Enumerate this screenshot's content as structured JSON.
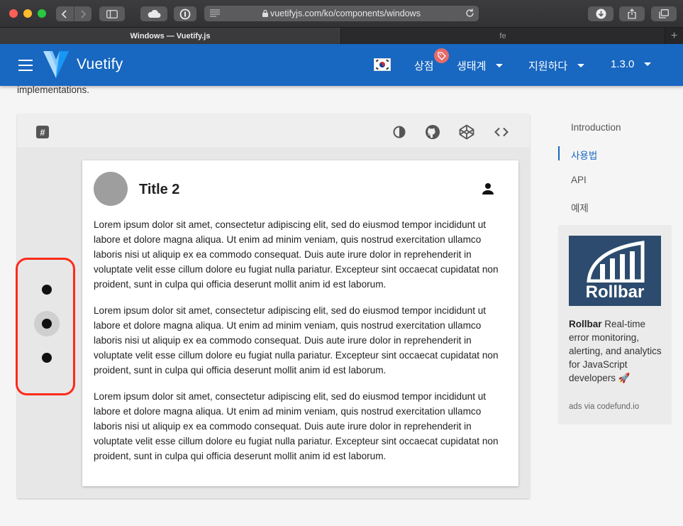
{
  "browser": {
    "url": "vuetifyjs.com/ko/components/windows",
    "tabs": [
      {
        "title": "Windows — Vuetify.js",
        "active": true
      },
      {
        "title": "fe",
        "active": false
      }
    ],
    "new_tab_label": "+"
  },
  "appbar": {
    "brand": "Vuetify",
    "store_label": "상점",
    "ecosystem_label": "생태계",
    "support_label": "지원하다",
    "version_label": "1.3.0",
    "color": "#1867c0"
  },
  "page": {
    "intro_fragment": "implementations."
  },
  "demo": {
    "hash_label": "#",
    "card_title": "Title 2",
    "paragraphs": [
      "Lorem ipsum dolor sit amet, consectetur adipiscing elit, sed do eiusmod tempor incididunt ut labore et dolore magna aliqua. Ut enim ad minim veniam, quis nostrud exercitation ullamco laboris nisi ut aliquip ex ea commodo consequat. Duis aute irure dolor in reprehenderit in voluptate velit esse cillum dolore eu fugiat nulla pariatur. Excepteur sint occaecat cupidatat non proident, sunt in culpa qui officia deserunt mollit anim id est laborum.",
      "Lorem ipsum dolor sit amet, consectetur adipiscing elit, sed do eiusmod tempor incididunt ut labore et dolore magna aliqua. Ut enim ad minim veniam, quis nostrud exercitation ullamco laboris nisi ut aliquip ex ea commodo consequat. Duis aute irure dolor in reprehenderit in voluptate velit esse cillum dolore eu fugiat nulla pariatur. Excepteur sint occaecat cupidatat non proident, sunt in culpa qui officia deserunt mollit anim id est laborum.",
      "Lorem ipsum dolor sit amet, consectetur adipiscing elit, sed do eiusmod tempor incididunt ut labore et dolore magna aliqua. Ut enim ad minim veniam, quis nostrud exercitation ullamco laboris nisi ut aliquip ex ea commodo consequat. Duis aute irure dolor in reprehenderit in voluptate velit esse cillum dolore eu fugiat nulla pariatur. Excepteur sint occaecat cupidatat non proident, sunt in culpa qui officia deserunt mollit anim id est laborum."
    ],
    "window_count": 3,
    "active_window": 2,
    "highlight_color": "#ff2a1a"
  },
  "toc": {
    "items": [
      "Introduction",
      "사용법",
      "API",
      "예제"
    ],
    "active_index": 1
  },
  "ad": {
    "image_word": "Rollbar",
    "brand": "Rollbar",
    "text": " Real-time error monitoring, alerting, and analytics for JavaScript developers 🚀",
    "via": "ads via codefund.io"
  }
}
